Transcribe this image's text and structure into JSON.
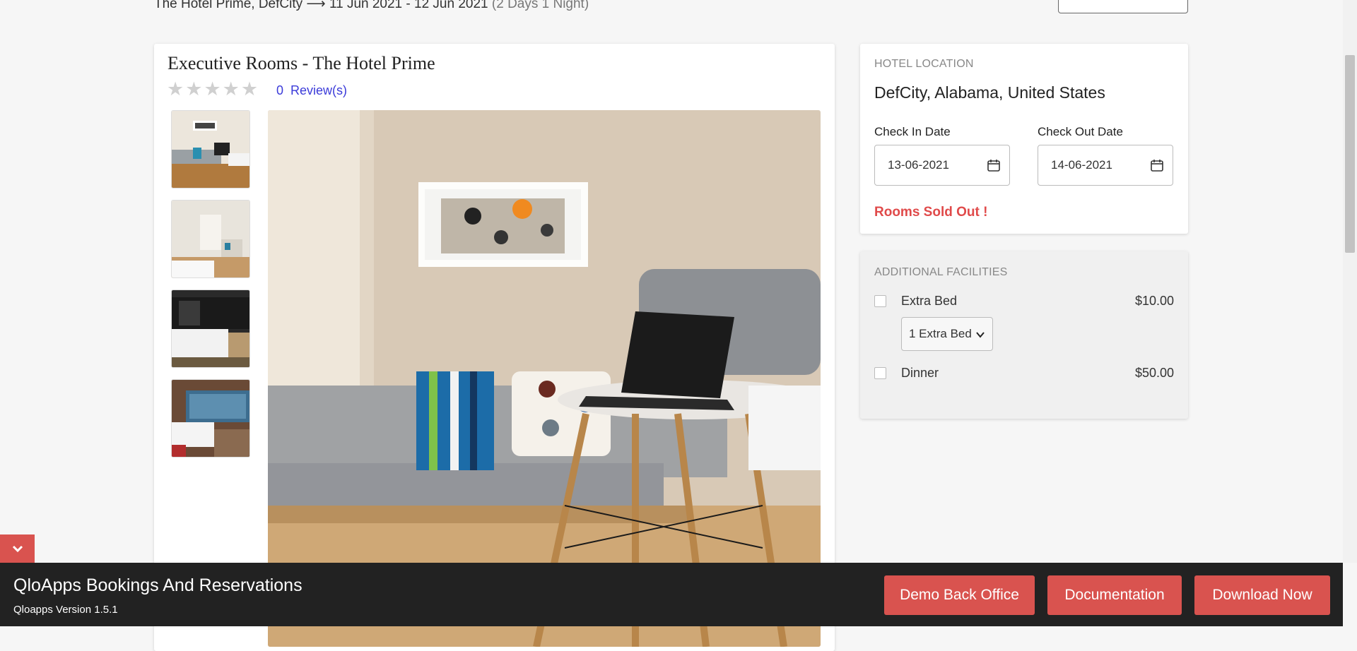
{
  "breadcrumb": {
    "hotel": "The Hotel Prime, DefCity",
    "arrow": "⟶",
    "dates": "11 Jun 2021 - 12 Jun 2021",
    "duration": "(2 Days 1 Night)"
  },
  "room": {
    "title": "Executive Rooms - The Hotel Prime",
    "rating_stars": 0,
    "review_count": "0",
    "review_label": "Review(s)"
  },
  "location": {
    "section_label": "HOTEL LOCATION",
    "value": "DefCity, Alabama, United States",
    "check_in_label": "Check In Date",
    "check_in_value": "13-06-2021",
    "check_out_label": "Check Out Date",
    "check_out_value": "14-06-2021",
    "status": "Rooms Sold Out !"
  },
  "facilities": {
    "section_label": "ADDITIONAL FACILITIES",
    "items": [
      {
        "name": "Extra Bed",
        "price": "$10.00",
        "checked": false,
        "select_value": "1 Extra Bed"
      },
      {
        "name": "Dinner",
        "price": "$50.00",
        "checked": false
      }
    ]
  },
  "footer": {
    "title": "QloApps Bookings And Reservations",
    "version": "Qloapps Version 1.5.1",
    "buttons": [
      "Demo Back Office",
      "Documentation",
      "Download Now"
    ]
  },
  "colors": {
    "accent": "#d9534f",
    "sold_out": "#e04a4a",
    "link": "#3b3bd9",
    "footer_bg": "#222222"
  },
  "icons": [
    "calendar-icon",
    "chevron-down-icon",
    "star-icon"
  ]
}
